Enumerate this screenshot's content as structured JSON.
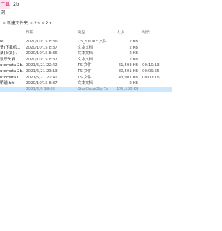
{
  "ribbon": {
    "tools_tab": "工具",
    "folder_title": "2b",
    "view_tab": "浏"
  },
  "breadcrumb": {
    "chevron": ">",
    "parts": [
      "新建文件夹",
      "2b",
      "2b"
    ]
  },
  "columns": {
    "date": "日期",
    "type": "类型",
    "size": "大小",
    "length": "时长"
  },
  "files": [
    {
      "name": "re",
      "date": "2020/10/15 8:36",
      "type": "DS_STORE 文件",
      "size": "2 KB",
      "length": ""
    },
    {
      "name": "请(下载机...",
      "date": "2020/10/15 8:37",
      "type": "文本文档",
      "size": "2 KB",
      "length": ""
    },
    {
      "name": "法(合集)..",
      "date": "2020/10/15 8:36",
      "type": "文本文档",
      "size": "2 KB",
      "length": ""
    },
    {
      "name": "饭乐头发...",
      "date": "2020/10/15 8:37",
      "type": "文本文档",
      "size": "2 KB",
      "length": ""
    },
    {
      "name": "utomata 2b...",
      "date": "2021/5/21 22:42",
      "type": "TS 文件",
      "size": "61,593 KB",
      "length": "00:10:13"
    },
    {
      "name": "utomata 2b...",
      "date": "2021/5/21 23:13",
      "type": "TS 文件",
      "size": "80,501 KB",
      "length": "00:09:55"
    },
    {
      "name": "utomata C...",
      "date": "2021/5/21 22:41",
      "type": "TS 文件",
      "size": "43,907 KB",
      "length": "00:07:16"
    },
    {
      "name": "明说.txt",
      "date": "2020/10/15 8:37",
      "type": "文本文档",
      "size": "2 KB",
      "length": ""
    },
    {
      "name": "",
      "date": "2021/6/9 18:05",
      "type": "StarCloudZip.7z",
      "size": "178,190 KB",
      "length": ""
    }
  ]
}
